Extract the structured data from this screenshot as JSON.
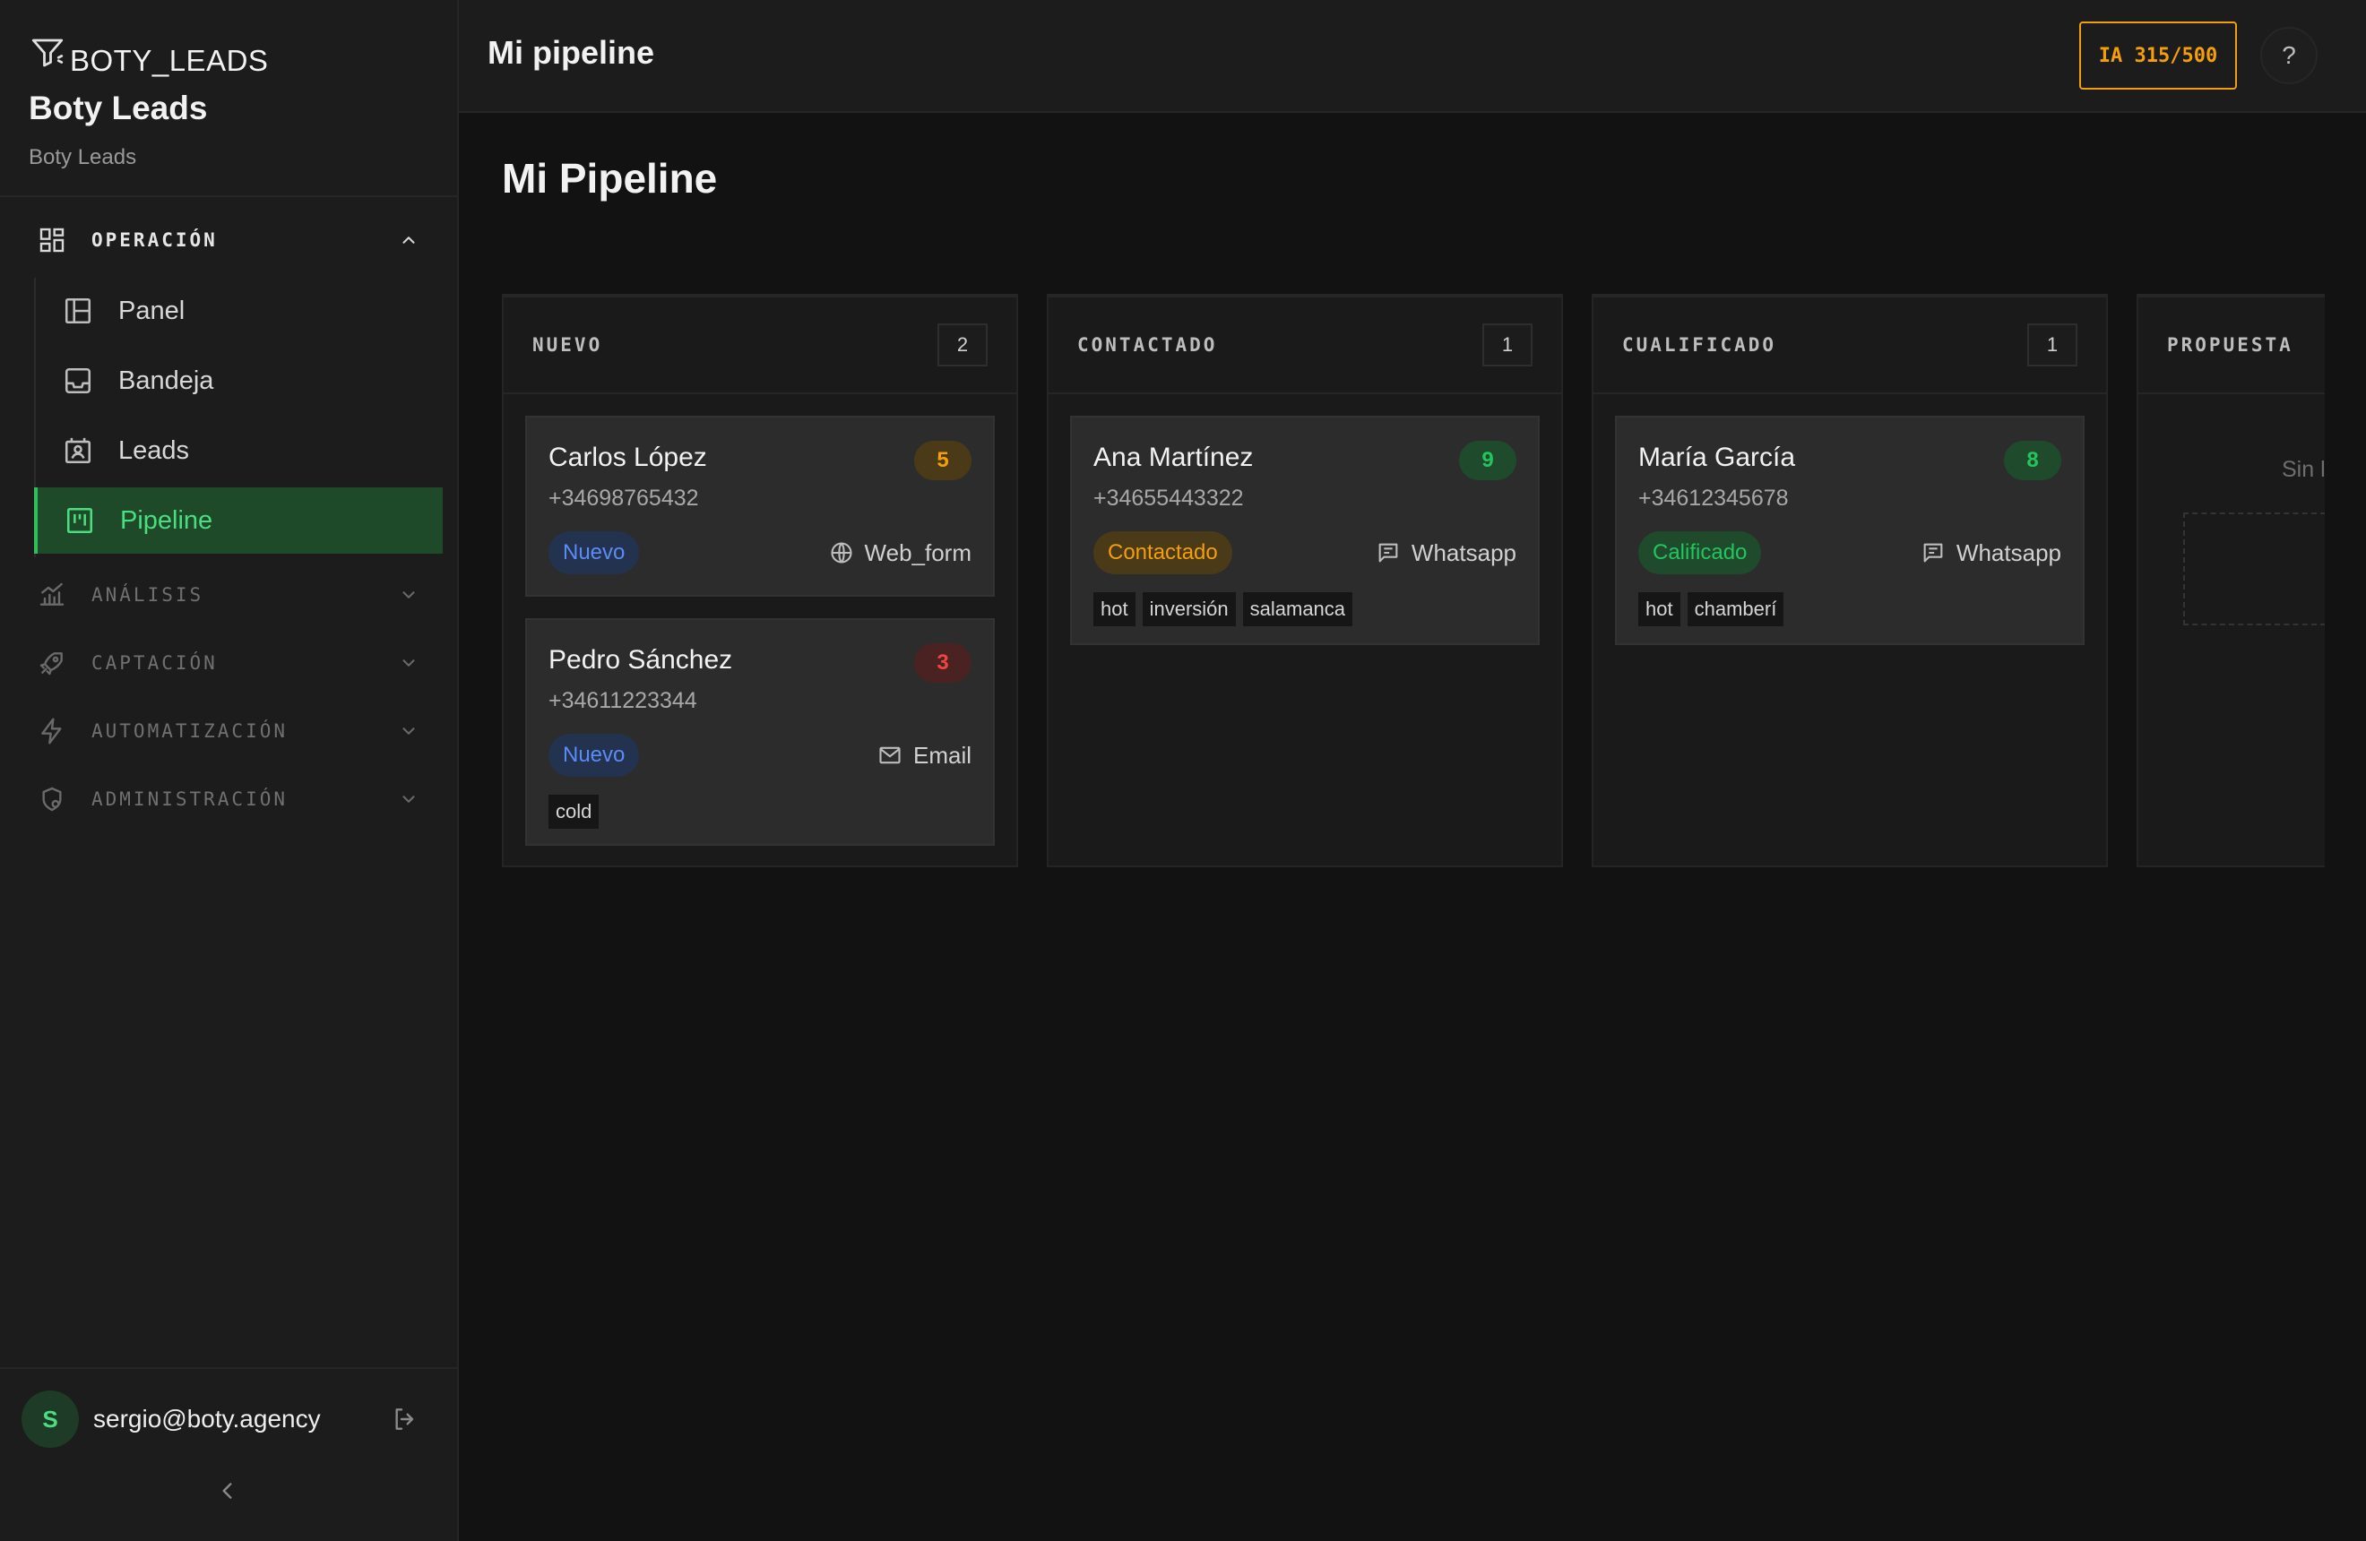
{
  "sidebar": {
    "logo_text": "BOTY_LEADS",
    "brand_title": "Boty Leads",
    "brand_subtitle": "Boty Leads",
    "sections": [
      {
        "label": "OPERACIÓN",
        "expanded": true,
        "icon": "grid-icon"
      },
      {
        "label": "ANÁLISIS",
        "expanded": false,
        "icon": "chart-icon"
      },
      {
        "label": "CAPTACIÓN",
        "expanded": false,
        "icon": "rocket-icon"
      },
      {
        "label": "AUTOMATIZACIÓN",
        "expanded": false,
        "icon": "bolt-icon"
      },
      {
        "label": "ADMINISTRACIÓN",
        "expanded": false,
        "icon": "shield-icon"
      }
    ],
    "nav_items": [
      {
        "label": "Panel",
        "icon": "layout-icon"
      },
      {
        "label": "Bandeja",
        "icon": "inbox-icon"
      },
      {
        "label": "Leads",
        "icon": "contacts-icon"
      },
      {
        "label": "Pipeline",
        "icon": "kanban-icon",
        "active": true
      }
    ],
    "user": {
      "avatar_initial": "S",
      "email": "sergio@boty.agency"
    }
  },
  "topbar": {
    "title": "Mi pipeline",
    "ia_usage": "IA 315/500"
  },
  "help_label": "?",
  "page_title": "Mi Pipeline",
  "columns": [
    {
      "title": "NUEVO",
      "count": "2",
      "cards": [
        {
          "name": "Carlos López",
          "phone": "+34698765432",
          "score": "5",
          "status": "Nuevo",
          "source": "Web_form",
          "source_icon": "globe-icon",
          "tags": []
        },
        {
          "name": "Pedro Sánchez",
          "phone": "+34611223344",
          "score": "3",
          "status": "Nuevo",
          "source": "Email",
          "source_icon": "mail-icon",
          "tags": [
            "cold"
          ]
        }
      ]
    },
    {
      "title": "CONTACTADO",
      "count": "1",
      "cards": [
        {
          "name": "Ana Martínez",
          "phone": "+34655443322",
          "score": "9",
          "status": "Contactado",
          "source": "Whatsapp",
          "source_icon": "message-icon",
          "tags": [
            "hot",
            "inversión",
            "salamanca"
          ]
        }
      ]
    },
    {
      "title": "CUALIFICADO",
      "count": "1",
      "cards": [
        {
          "name": "María García",
          "phone": "+34612345678",
          "score": "8",
          "status": "Calificado",
          "source": "Whatsapp",
          "source_icon": "message-icon",
          "tags": [
            "hot",
            "chamberí"
          ]
        }
      ]
    },
    {
      "title": "PROPUESTA",
      "empty_text": "Sin l"
    }
  ],
  "colors": {
    "accent_green": "#4ade80",
    "active_bg": "#1e4a29",
    "ia_orange": "#f59e0b",
    "status_nuevo": "#4f7df0",
    "status_contactado": "#f59e0b",
    "status_calificado": "#22c55e",
    "score_orange": "#f59e0b",
    "score_red": "#ef4444",
    "score_green": "#22c55e"
  }
}
